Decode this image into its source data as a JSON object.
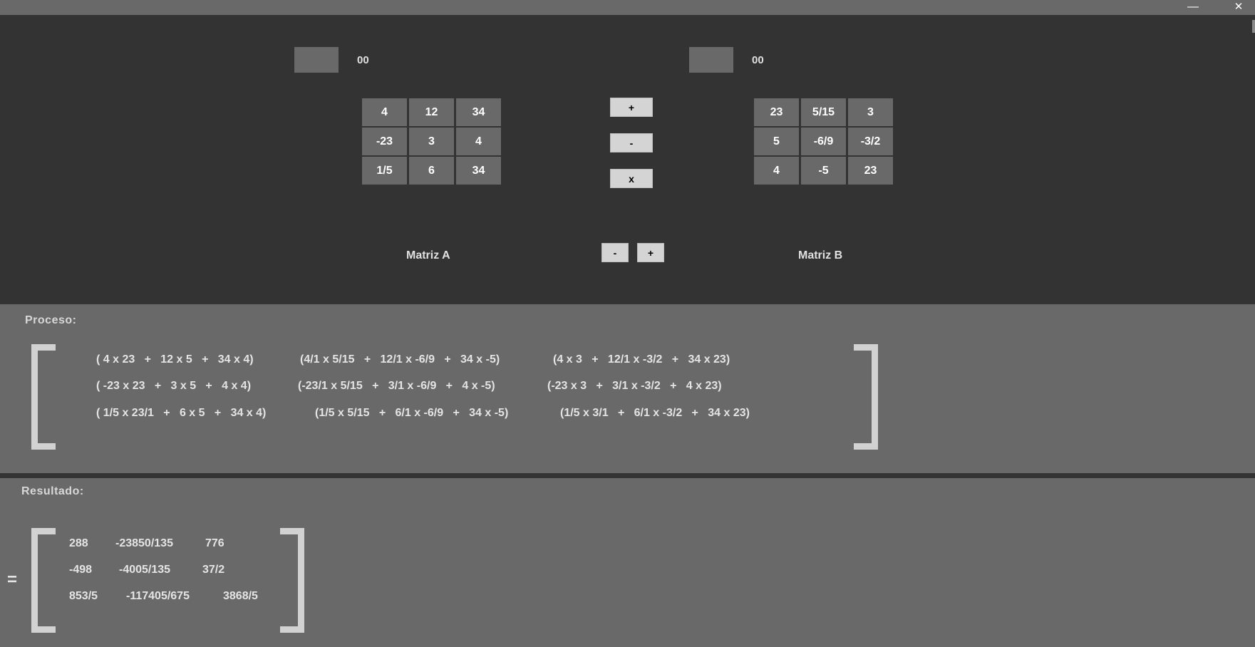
{
  "window": {
    "minimize_glyph": "—",
    "close_glyph": "✕"
  },
  "matrix_a": {
    "size_label": "00",
    "title": "Matriz A",
    "cells": [
      [
        "4",
        "12",
        "34"
      ],
      [
        "-23",
        "3",
        "4"
      ],
      [
        "1/5",
        "6",
        "34"
      ]
    ]
  },
  "matrix_b": {
    "size_label": "00",
    "title": "Matriz B",
    "cells": [
      [
        "23",
        "5/15",
        "3"
      ],
      [
        "5",
        "-6/9",
        "-3/2"
      ],
      [
        "4",
        "-5",
        "23"
      ]
    ]
  },
  "operations": {
    "add": "+",
    "subtract": "-",
    "multiply": "x"
  },
  "size_controls": {
    "decrease": "-",
    "increase": "+"
  },
  "process": {
    "label": "Proceso:",
    "rows": [
      [
        "( 4 x 23   +   12 x 5   +   34 x 4)",
        "(4/1 x 5/15   +   12/1 x -6/9   +   34 x -5)",
        "(4 x 3   +   12/1 x -3/2   +   34 x 23)"
      ],
      [
        "( -23 x 23   +   3 x 5   +   4 x 4)",
        "(-23/1 x 5/15   +   3/1 x -6/9   +   4 x -5)",
        "(-23 x 3   +   3/1 x -3/2   +   4 x 23)"
      ],
      [
        "( 1/5 x 23/1   +   6 x 5   +   34 x 4)",
        "(1/5 x 5/15   +   6/1 x -6/9   +   34 x -5)",
        "(1/5 x 3/1   +   6/1 x -3/2   +   34 x 23)"
      ]
    ]
  },
  "result": {
    "label": "Resultado:",
    "equals": "=",
    "rows": [
      [
        "288",
        "-23850/135",
        "776"
      ],
      [
        "-498",
        "-4005/135",
        "37/2"
      ],
      [
        "853/5",
        "-117405/675",
        "3868/5"
      ]
    ]
  },
  "colors": {
    "background": "#333333",
    "panel": "#696969",
    "button": "#d4d4d4",
    "bracket": "#d2d2d2"
  }
}
